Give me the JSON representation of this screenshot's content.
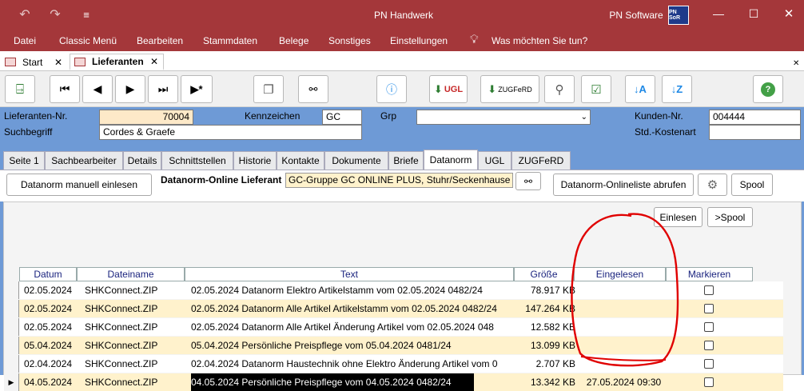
{
  "titlebar": {
    "app_title": "PN Handwerk",
    "company": "PN Software",
    "logo_text": "PN SoR"
  },
  "menu": {
    "items": [
      "Datei",
      "Classic Menü",
      "Bearbeiten",
      "Stammdaten",
      "Belege",
      "Sonstiges",
      "Einstellungen"
    ],
    "help_prompt": "Was möchten Sie tun?"
  },
  "doc_tabs": [
    {
      "label": "Start"
    },
    {
      "label": "Lieferanten"
    }
  ],
  "toolbar": {
    "ugl_label": "UGL",
    "zugferd_label": "ZUGFeRD"
  },
  "header": {
    "lieferanten_nr_label": "Lieferanten-Nr.",
    "lieferanten_nr_value": "70004",
    "kennzeichen_label": "Kennzeichen",
    "kennzeichen_value": "GC",
    "grp_label": "Grp",
    "grp_value": "",
    "kunden_nr_label": "Kunden-Nr.",
    "kunden_nr_value": "004444",
    "suchbegriff_label": "Suchbegriff",
    "suchbegriff_value": "Cordes & Graefe",
    "std_kostenart_label": "Std.-Kostenart",
    "std_kostenart_value": ""
  },
  "subtabs": [
    "Seite 1",
    "Sachbearbeiter",
    "Details",
    "Schnittstellen",
    "Historie",
    "Kontakte",
    "Dokumente",
    "Briefe",
    "Datanorm",
    "UGL",
    "ZUGFeRD"
  ],
  "datanorm": {
    "manual_button": "Datanorm manuell einlesen",
    "online_label": "Datanorm-Online Lieferant",
    "online_value": "GC-Gruppe GC ONLINE PLUS, Stuhr/Seckenhause",
    "online_list_button": "Datanorm-Onlineliste abrufen",
    "spool_button": "Spool",
    "einlesen_button": "Einlesen",
    "to_spool_button": ">Spool"
  },
  "table": {
    "columns": [
      "Datum",
      "Dateiname",
      "Text",
      "Größe",
      "Eingelesen",
      "Markieren"
    ],
    "rows": [
      {
        "datum": "02.05.2024",
        "datei": "SHKConnect.ZIP",
        "text": "02.05.2024 Datanorm Elektro Artikelstamm vom 02.05.2024 0482/24",
        "groesse": "78.917 KB",
        "eingelesen": ""
      },
      {
        "datum": "02.05.2024",
        "datei": "SHKConnect.ZIP",
        "text": "02.05.2024 Datanorm Alle Artikel Artikelstamm vom 02.05.2024 0482/24",
        "groesse": "147.264 KB",
        "eingelesen": ""
      },
      {
        "datum": "02.05.2024",
        "datei": "SHKConnect.ZIP",
        "text": "02.05.2024 Datanorm Alle Artikel Änderung Artikel vom 02.05.2024 048",
        "groesse": "12.582 KB",
        "eingelesen": ""
      },
      {
        "datum": "05.04.2024",
        "datei": "SHKConnect.ZIP",
        "text": "05.04.2024 Persönliche Preispflege vom 05.04.2024 0481/24",
        "groesse": "13.099 KB",
        "eingelesen": ""
      },
      {
        "datum": "02.04.2024",
        "datei": "SHKConnect.ZIP",
        "text": "02.04.2024 Datanorm Haustechnik ohne Elektro Änderung Artikel vom 0",
        "groesse": "2.707 KB",
        "eingelesen": ""
      },
      {
        "datum": "04.05.2024",
        "datei": "SHKConnect.ZIP",
        "text": "04.05.2024 Persönliche Preispflege vom 04.05.2024 0482/24",
        "groesse": "13.342 KB",
        "eingelesen": "27.05.2024 09:30"
      }
    ]
  },
  "colors": {
    "accent": "#a4373a",
    "header_bg": "#6e9ad6",
    "row_alt": "#fff2cc",
    "annotation": "#e00000"
  }
}
